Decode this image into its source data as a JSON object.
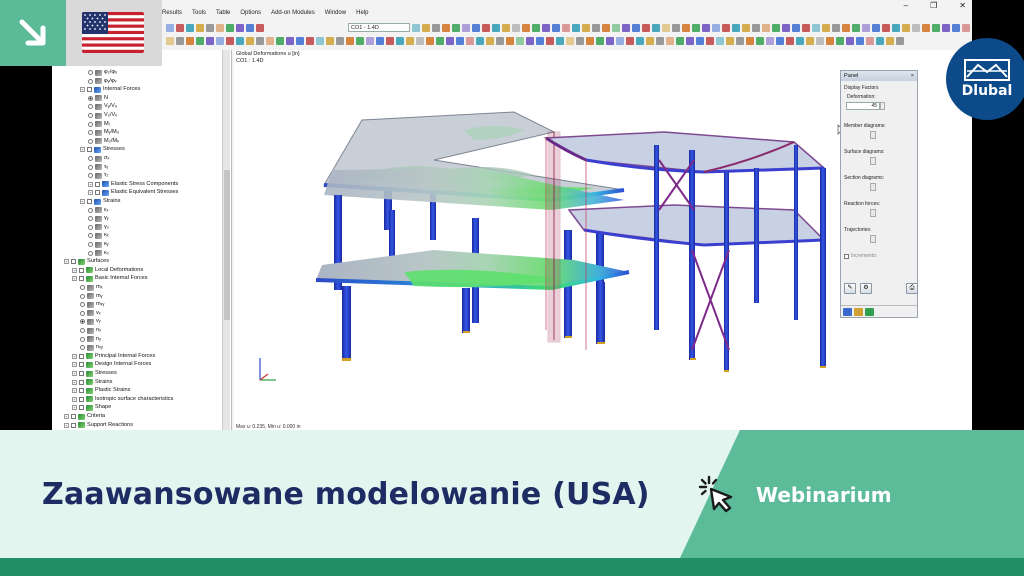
{
  "app": {
    "menu": [
      "Results",
      "Tools",
      "Table",
      "Options",
      "Add-on Modules",
      "Window",
      "Help"
    ],
    "load_case": "CO1 - 1.4D",
    "window_controls": [
      "–",
      "❐",
      "✕"
    ]
  },
  "navigator": {
    "items": [
      {
        "label": "φ₂/φᵤ",
        "indent": 3,
        "type": "radio"
      },
      {
        "label": "φᵧ/φᵥ",
        "indent": 3,
        "type": "radio"
      },
      {
        "label": "Internal Forces",
        "indent": 2,
        "type": "folder"
      },
      {
        "label": "N",
        "indent": 3,
        "type": "radio",
        "on": true
      },
      {
        "label": "Vᵧ/Vᵤ",
        "indent": 3,
        "type": "radio"
      },
      {
        "label": "V₂/Vᵥ",
        "indent": 3,
        "type": "radio"
      },
      {
        "label": "Mₜ",
        "indent": 3,
        "type": "radio"
      },
      {
        "label": "Mᵧ/Mᵤ",
        "indent": 3,
        "type": "radio"
      },
      {
        "label": "M₂/Mᵥ",
        "indent": 3,
        "type": "radio"
      },
      {
        "label": "Stresses",
        "indent": 2,
        "type": "folder"
      },
      {
        "label": "σₓ",
        "indent": 3,
        "type": "radio"
      },
      {
        "label": "τᵧ",
        "indent": 3,
        "type": "radio"
      },
      {
        "label": "τ₂",
        "indent": 3,
        "type": "radio"
      },
      {
        "label": "Elastic Stress Components",
        "indent": 3,
        "type": "folder"
      },
      {
        "label": "Elastic Equivalent Stresses",
        "indent": 3,
        "type": "folder"
      },
      {
        "label": "Strains",
        "indent": 2,
        "type": "folder"
      },
      {
        "label": "εₓ",
        "indent": 3,
        "type": "radio"
      },
      {
        "label": "γᵧ",
        "indent": 3,
        "type": "radio"
      },
      {
        "label": "γ₂",
        "indent": 3,
        "type": "radio"
      },
      {
        "label": "κₓ",
        "indent": 3,
        "type": "radio"
      },
      {
        "label": "κᵧ",
        "indent": 3,
        "type": "radio"
      },
      {
        "label": "κ₂",
        "indent": 3,
        "type": "radio"
      },
      {
        "label": "Surfaces",
        "indent": 0,
        "type": "root"
      },
      {
        "label": "Local Deformations",
        "indent": 1,
        "type": "folder"
      },
      {
        "label": "Basic Internal Forces",
        "indent": 1,
        "type": "folder"
      },
      {
        "label": "mₓ",
        "indent": 2,
        "type": "radio"
      },
      {
        "label": "mᵧ",
        "indent": 2,
        "type": "radio"
      },
      {
        "label": "mₓᵧ",
        "indent": 2,
        "type": "radio"
      },
      {
        "label": "vₓ",
        "indent": 2,
        "type": "radio"
      },
      {
        "label": "vᵧ",
        "indent": 2,
        "type": "radio",
        "on": true
      },
      {
        "label": "nₓ",
        "indent": 2,
        "type": "radio"
      },
      {
        "label": "nᵧ",
        "indent": 2,
        "type": "radio"
      },
      {
        "label": "nₓᵧ",
        "indent": 2,
        "type": "radio"
      },
      {
        "label": "Principal Internal Forces",
        "indent": 1,
        "type": "folder"
      },
      {
        "label": "Design Internal Forces",
        "indent": 1,
        "type": "folder"
      },
      {
        "label": "Stresses",
        "indent": 1,
        "type": "folder"
      },
      {
        "label": "Strains",
        "indent": 1,
        "type": "folder"
      },
      {
        "label": "Plastic Strains",
        "indent": 1,
        "type": "folder"
      },
      {
        "label": "Isotropic surface characteristics",
        "indent": 1,
        "type": "folder"
      },
      {
        "label": "Shape",
        "indent": 1,
        "type": "folder"
      },
      {
        "label": "Criteria",
        "indent": 0,
        "type": "root"
      },
      {
        "label": "Support Reactions",
        "indent": 0,
        "type": "root"
      }
    ]
  },
  "viewport": {
    "title": "Global Deformations u [in]",
    "subtitle": "CO1 : 1.4D",
    "status": "Max u: 0.235, Min u: 0.000 in"
  },
  "panel": {
    "title": "Panel",
    "close": "×",
    "display_factors": "Display Factors",
    "deformation_label": "Deformation:",
    "deformation_value": "45",
    "member_diagrams": "Member diagrams:",
    "surface_diagrams": "Surface diagrams:",
    "section_diagrams": "Section diagrams:",
    "reaction_forces": "Reaction forces:",
    "trajectories": "Trajectories:",
    "increments": "Increments:"
  },
  "banner": {
    "title": "Zaawansowane modelowanie (USA)",
    "label": "Webinarium"
  },
  "brand": {
    "name": "Dlubal",
    "accent": "#5bbb98",
    "navy": "#1e2c64",
    "dlubal_blue": "#0d4a8a",
    "dark_green": "#238f66"
  },
  "icons": [
    "arrow-down-right-icon",
    "us-flag-icon",
    "dlubal-logo-icon",
    "click-cursor-icon",
    "axes-icon"
  ]
}
